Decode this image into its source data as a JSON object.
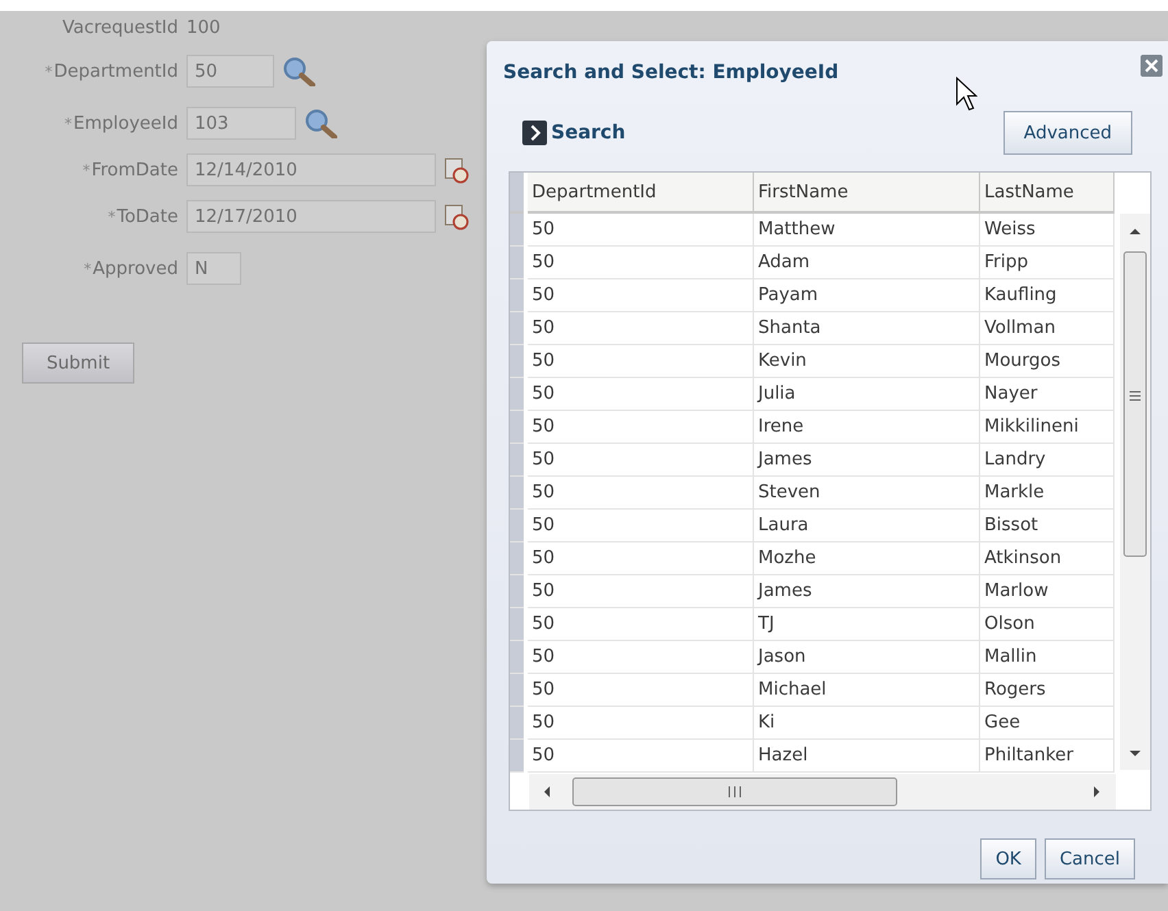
{
  "form": {
    "fields": [
      {
        "kind": "readonly",
        "label": "VacrequestId",
        "required": false,
        "value": "100"
      },
      {
        "kind": "lookup",
        "label": "DepartmentId",
        "required": true,
        "value": "50"
      },
      {
        "kind": "lookup",
        "label": "EmployeeId",
        "required": true,
        "value": "103"
      },
      {
        "kind": "date",
        "label": "FromDate",
        "required": true,
        "value": "12/14/2010"
      },
      {
        "kind": "date",
        "label": "ToDate",
        "required": true,
        "value": "12/17/2010"
      },
      {
        "kind": "short",
        "label": "Approved",
        "required": true,
        "value": "N"
      }
    ],
    "required_mark": "*",
    "submit": "Submit"
  },
  "dialog": {
    "title": "Search and Select: EmployeeId",
    "search_label": "Search",
    "advanced_button": "Advanced",
    "table": {
      "columns": [
        "DepartmentId",
        "FirstName",
        "LastName"
      ],
      "rows": [
        [
          "50",
          "Matthew",
          "Weiss"
        ],
        [
          "50",
          "Adam",
          "Fripp"
        ],
        [
          "50",
          "Payam",
          "Kaufling"
        ],
        [
          "50",
          "Shanta",
          "Vollman"
        ],
        [
          "50",
          "Kevin",
          "Mourgos"
        ],
        [
          "50",
          "Julia",
          "Nayer"
        ],
        [
          "50",
          "Irene",
          "Mikkilineni"
        ],
        [
          "50",
          "James",
          "Landry"
        ],
        [
          "50",
          "Steven",
          "Markle"
        ],
        [
          "50",
          "Laura",
          "Bissot"
        ],
        [
          "50",
          "Mozhe",
          "Atkinson"
        ],
        [
          "50",
          "James",
          "Marlow"
        ],
        [
          "50",
          "TJ",
          "Olson"
        ],
        [
          "50",
          "Jason",
          "Mallin"
        ],
        [
          "50",
          "Michael",
          "Rogers"
        ],
        [
          "50",
          "Ki",
          "Gee"
        ],
        [
          "50",
          "Hazel",
          "Philtanker"
        ]
      ]
    },
    "buttons": [
      "OK",
      "Cancel"
    ]
  }
}
